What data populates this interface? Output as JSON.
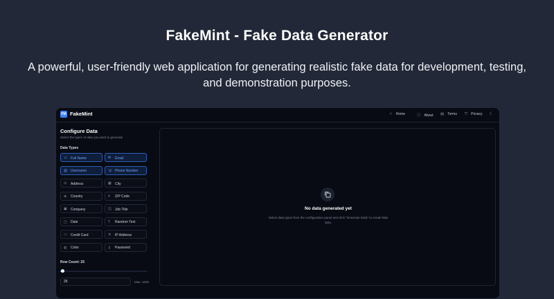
{
  "hero": {
    "title": "FakeMint - Fake Data Generator",
    "subtitle": "A powerful, user-friendly web application for generating realistic fake data for development, testing, and demonstration purposes."
  },
  "app": {
    "logo_badge": "FM",
    "logo_text": "FakeMint",
    "accent": "#3b82f6",
    "nav": [
      {
        "icon": "sparkle-icon",
        "glyph": "✧",
        "label": "Home"
      },
      {
        "icon": "info-icon",
        "glyph": "ⓘ",
        "label": "About"
      },
      {
        "icon": "document-icon",
        "glyph": "▤",
        "label": "Terms"
      },
      {
        "icon": "shield-icon",
        "glyph": "⛉",
        "label": "Privacy"
      }
    ],
    "theme_icon": "moon-icon"
  },
  "sidebar": {
    "title": "Configure Data",
    "description": "Select the types of data you want to generate",
    "types_label": "Data Types",
    "data_types": [
      {
        "label": "Full Name",
        "icon": "user-icon",
        "glyph": "☺",
        "selected": true
      },
      {
        "label": "Email",
        "icon": "mail-icon",
        "glyph": "✉",
        "selected": true
      },
      {
        "label": "Username",
        "icon": "at-icon",
        "glyph": "@",
        "selected": true
      },
      {
        "label": "Phone Number",
        "icon": "phone-icon",
        "glyph": "☏",
        "selected": true
      },
      {
        "label": "Address",
        "icon": "pin-icon",
        "glyph": "⊙",
        "selected": false
      },
      {
        "label": "City",
        "icon": "building-icon",
        "glyph": "▦",
        "selected": false
      },
      {
        "label": "Country",
        "icon": "globe-icon",
        "glyph": "⊕",
        "selected": false
      },
      {
        "label": "ZIP Code",
        "icon": "hash-icon",
        "glyph": "#",
        "selected": false
      },
      {
        "label": "Company",
        "icon": "briefcase-icon",
        "glyph": "▣",
        "selected": false
      },
      {
        "label": "Job Title",
        "icon": "badge-icon",
        "glyph": "◫",
        "selected": false
      },
      {
        "label": "Date",
        "icon": "calendar-icon",
        "glyph": "▢",
        "selected": false
      },
      {
        "label": "Random Text",
        "icon": "text-icon",
        "glyph": "T",
        "selected": false
      },
      {
        "label": "Credit Card",
        "icon": "credit-card-icon",
        "glyph": "▭",
        "selected": false
      },
      {
        "label": "IP Address",
        "icon": "network-icon",
        "glyph": "⋔",
        "selected": false
      },
      {
        "label": "Color",
        "icon": "palette-icon",
        "glyph": "◍",
        "selected": false
      },
      {
        "label": "Password",
        "icon": "key-icon",
        "glyph": "⚷",
        "selected": false
      }
    ],
    "row_count_label": "Row Count: 25",
    "row_count_value": "25",
    "row_count_max": "Max: 1000",
    "row_count_fraction": 0.025
  },
  "output": {
    "empty_icon": "copy-icon",
    "empty_title": "No data generated yet",
    "empty_desc": "Select data types from the configuration panel and click \"Generate Data\" to create fake data."
  }
}
